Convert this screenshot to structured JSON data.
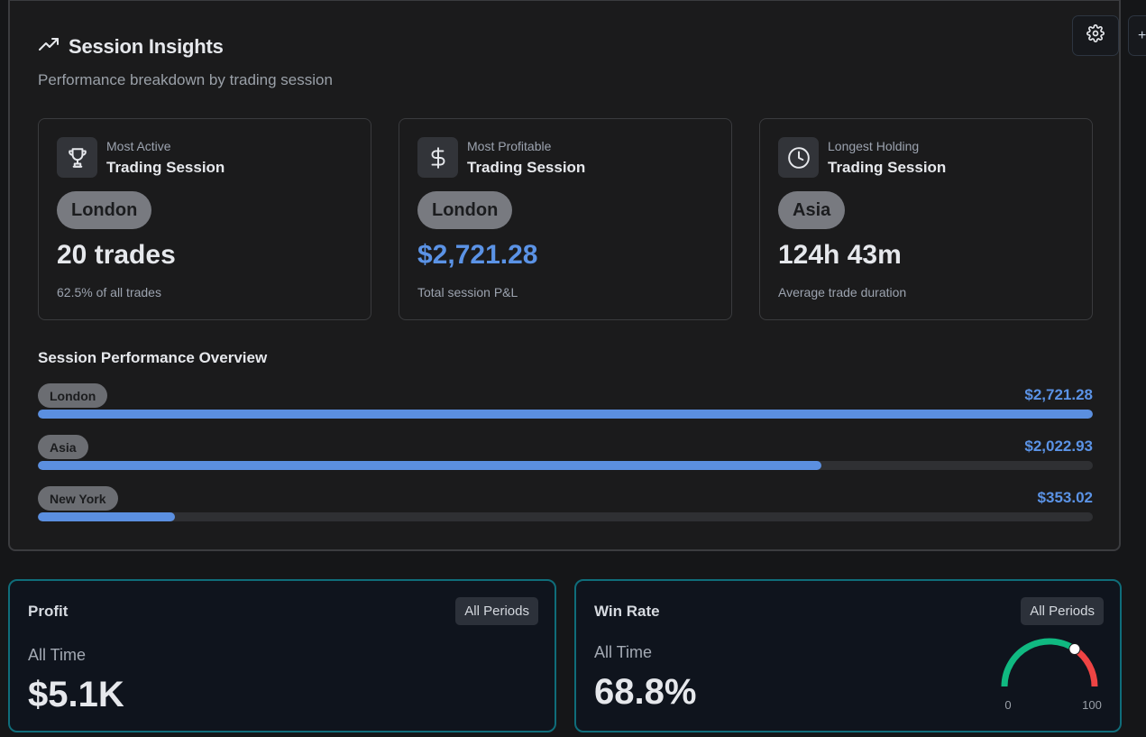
{
  "header": {
    "title": "Session Insights",
    "subtitle": "Performance breakdown by trading session",
    "edge_button_glyph": "+"
  },
  "cards": [
    {
      "kicker": "Most Active",
      "heading": "Trading Session",
      "session": "London",
      "value": "20 trades",
      "note": "62.5% of all trades",
      "icon": "trophy-icon"
    },
    {
      "kicker": "Most Profitable",
      "heading": "Trading Session",
      "session": "London",
      "value": "$2,721.28",
      "note": "Total session P&L",
      "icon": "dollar-icon"
    },
    {
      "kicker": "Longest Holding",
      "heading": "Trading Session",
      "session": "Asia",
      "value": "124h 43m",
      "note": "Average trade duration",
      "icon": "clock-icon"
    }
  ],
  "overview": {
    "title": "Session Performance Overview",
    "rows": [
      {
        "session": "London",
        "amount": "$2,721.28",
        "fraction": 1.0
      },
      {
        "session": "Asia",
        "amount": "$2,022.93",
        "fraction": 0.743
      },
      {
        "session": "New York",
        "amount": "$353.02",
        "fraction": 0.13
      }
    ]
  },
  "profit_card": {
    "title": "Profit",
    "badge": "All Periods",
    "period": "All Time",
    "value": "$5.1K"
  },
  "winrate_card": {
    "title": "Win Rate",
    "badge": "All Periods",
    "period": "All Time",
    "value": "68.8%",
    "gauge": {
      "min_label": "0",
      "max_label": "100",
      "percent": 68.8
    }
  },
  "colors": {
    "accent_blue": "#5b93e6",
    "gauge_green": "#10b981",
    "gauge_red": "#ef4444",
    "teal_border": "#0f6d7a"
  }
}
